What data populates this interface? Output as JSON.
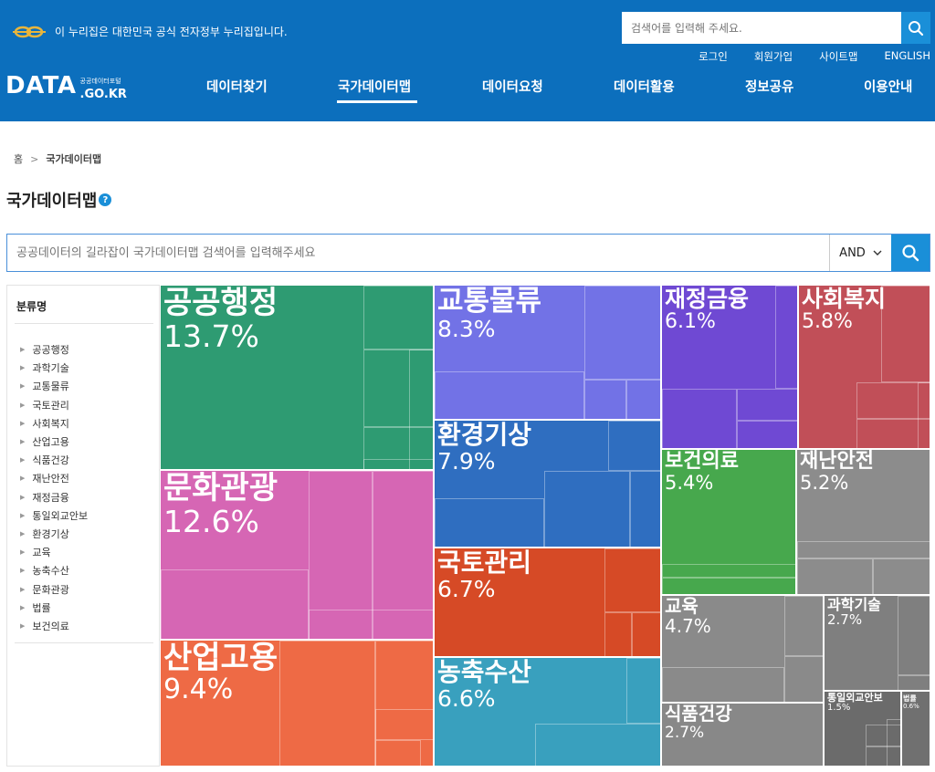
{
  "gov_banner": {
    "text": "이 누리집은 대한민국 공식 전자정부 누리집입니다."
  },
  "top_search": {
    "placeholder": "검색어를 입력해 주세요."
  },
  "util_links": [
    "로그인",
    "회원가입",
    "사이트맵",
    "ENGLISH"
  ],
  "logo": {
    "main": "DATA",
    "sub_kor": "공공데이터포털",
    "sub_domain": ".GO.KR"
  },
  "nav": [
    {
      "label": "데이터찾기",
      "active": false
    },
    {
      "label": "국가데이터맵",
      "active": true
    },
    {
      "label": "데이터요청",
      "active": false
    },
    {
      "label": "데이터활용",
      "active": false
    },
    {
      "label": "정보공유",
      "active": false
    },
    {
      "label": "이용안내",
      "active": false
    }
  ],
  "breadcrumb": {
    "home": "홈",
    "separator": ">",
    "current": "국가데이터맵"
  },
  "page_title": "국가데이터맵",
  "help_icon_glyph": "?",
  "map_search": {
    "placeholder": "공공데이터의 길라잡이 국가데이터맵 검색어를 입력해주세요",
    "operator": "AND"
  },
  "sidebar": {
    "heading": "분류명",
    "items": [
      "공공행정",
      "과학기술",
      "교통물류",
      "국토관리",
      "사회복지",
      "산업고용",
      "식품건강",
      "재난안전",
      "재정금융",
      "통일외교안보",
      "환경기상",
      "교육",
      "농축수산",
      "문화관광",
      "법률",
      "보건의료"
    ]
  },
  "treemap": {
    "categories": [
      {
        "name": "공공행정",
        "percent": "13.7%",
        "color": "#2e9b72"
      },
      {
        "name": "문화관광",
        "percent": "12.6%",
        "color": "#d666b4"
      },
      {
        "name": "산업고용",
        "percent": "9.4%",
        "color": "#ee6a45"
      },
      {
        "name": "교통물류",
        "percent": "8.3%",
        "color": "#7272e6"
      },
      {
        "name": "환경기상",
        "percent": "7.9%",
        "color": "#2f6ec0"
      },
      {
        "name": "국토관리",
        "percent": "6.7%",
        "color": "#d64a26"
      },
      {
        "name": "농축수산",
        "percent": "6.6%",
        "color": "#39a0be"
      },
      {
        "name": "재정금융",
        "percent": "6.1%",
        "color": "#6f49d3"
      },
      {
        "name": "사회복지",
        "percent": "5.8%",
        "color": "#c14f58"
      },
      {
        "name": "보건의료",
        "percent": "5.4%",
        "color": "#47a84d"
      },
      {
        "name": "재난안전",
        "percent": "5.2%",
        "color": "#8c8c8c"
      },
      {
        "name": "교육",
        "percent": "4.7%",
        "color": "#8a8a8a"
      },
      {
        "name": "과학기술",
        "percent": "2.7%",
        "color": "#7f7f7f"
      },
      {
        "name": "식품건강",
        "percent": "2.7%",
        "color": "#888888"
      },
      {
        "name": "통일외교안보",
        "percent": "1.5%",
        "color": "#6b6b6b"
      },
      {
        "name": "법률",
        "percent": "0.6%",
        "color": "#707070"
      }
    ]
  }
}
